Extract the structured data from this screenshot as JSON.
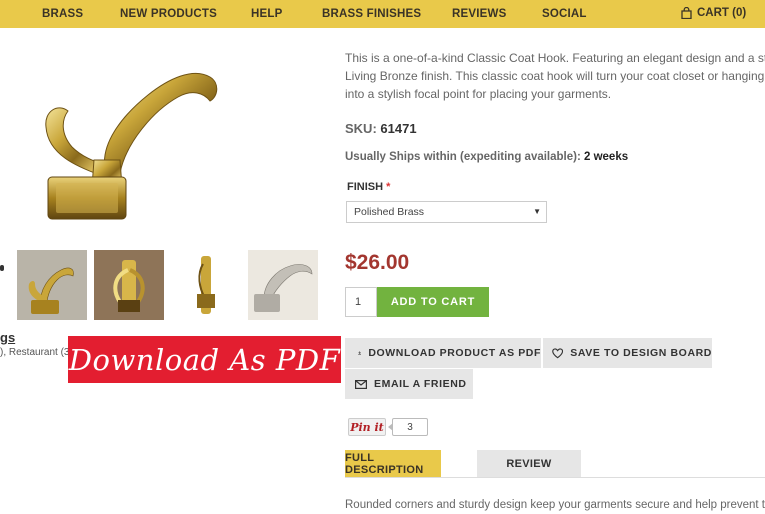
{
  "nav": {
    "items": [
      {
        "label": "BRASS"
      },
      {
        "label": "NEW PRODUCTS"
      },
      {
        "label": "HELP"
      },
      {
        "label": "BRASS FINISHES"
      },
      {
        "label": "REVIEWS"
      },
      {
        "label": "SOCIAL"
      }
    ],
    "cart_label": "CART (0)"
  },
  "gallery": {
    "tags_label": "gs",
    "tags_text": "), Restaurant (3",
    "thumbnail_count": 4
  },
  "pdf_banner": {
    "label": "Download As PDF"
  },
  "product": {
    "description_lines": [
      "This is a one-of-a-kind Classic Coat Hook. Featuring an elegant design and a strik",
      "Living Bronze finish. This classic coat hook will turn your coat closet or hanging w",
      "into a stylish focal point for placing your garments."
    ],
    "sku_label": "SKU:",
    "sku_value": "61471",
    "ships_label": "Usually Ships within (expediting available):",
    "ships_value": "2 weeks",
    "finish_label": "FINISH",
    "finish_required_mark": "*",
    "finish_selected": "Polished Brass",
    "price": "$26.00",
    "quantity": "1",
    "add_to_cart_label": "ADD TO CART",
    "download_label": "DOWNLOAD PRODUCT AS PDF",
    "save_label": "SAVE TO DESIGN BOARD",
    "email_label": "EMAIL A FRIEND",
    "pin_label": "Pin it",
    "pin_count": "3"
  },
  "tabs": [
    {
      "label": "FULL DESCRIPTION",
      "active": true
    },
    {
      "label": "REVIEW",
      "active": false
    }
  ],
  "full_description": "Rounded corners and sturdy design keep your garments secure and help prevent tears. S",
  "colors": {
    "nav_bg": "#e9c94a",
    "price": "#a3362f",
    "add_to_cart": "#72b33f",
    "pdf_banner": "#e31e30",
    "button_gray": "#e6e6e6"
  }
}
